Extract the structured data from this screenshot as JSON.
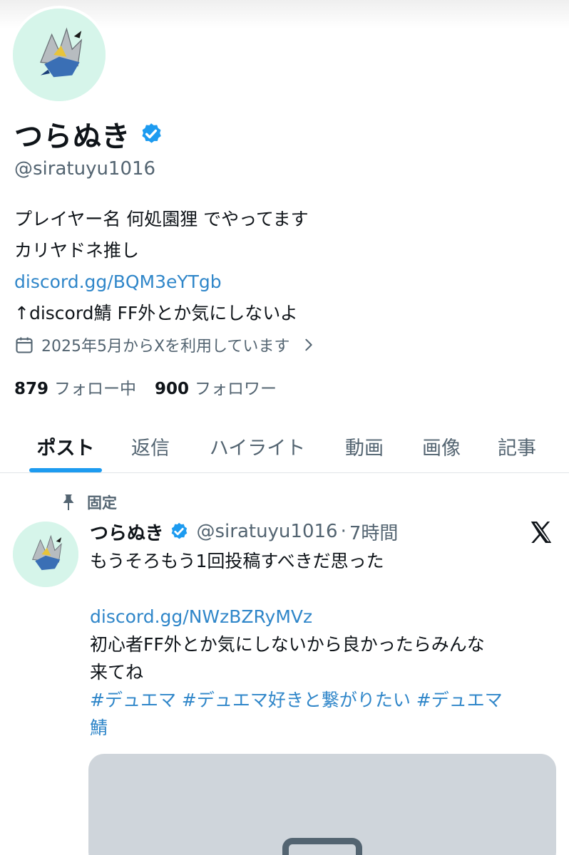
{
  "profile": {
    "display_name": "つらぬき",
    "handle": "@siratuyu1016",
    "bio": {
      "line1": "プレイヤー名 何処園狸 でやってます",
      "line2": "カリヤドネ推し",
      "link": "discord.gg/BQM3eYTgb",
      "line4": "↑discord鯖 FF外とか気にしないよ"
    },
    "joined": "2025年5月からXを利用しています",
    "following_count": "879",
    "following_label": "フォロー中",
    "followers_count": "900",
    "followers_label": "フォロワー"
  },
  "tabs": [
    {
      "label": "ポスト",
      "active": true
    },
    {
      "label": "返信"
    },
    {
      "label": "ハイライト"
    },
    {
      "label": "動画"
    },
    {
      "label": "画像"
    },
    {
      "label": "記事"
    }
  ],
  "pinned_post": {
    "pinned_label": "固定",
    "author_name": "つらぬき",
    "author_handle": "@siratuyu1016",
    "separator": "·",
    "time": "7時間",
    "text_line1": "もうそろもう1回投稿すべきだ思った",
    "link": "discord.gg/NWzBZRyMVz",
    "text_line3": "初心者FF外とか気にしないから良かったらみんな",
    "text_line4": "来てね",
    "hashtags_line1": " #デュエマ #デュエマ好きと繋がりたい #デュエマ",
    "hashtags_line2": "鯖"
  },
  "colors": {
    "accent": "#1d9bf0",
    "link": "#2f86c9",
    "secondary_text": "#536471",
    "avatar_bg": "#d6f5ea"
  },
  "icons": [
    "verified-badge-icon",
    "calendar-icon",
    "chevron-right-icon",
    "pin-icon",
    "x-logo-icon",
    "image-placeholder-icon"
  ]
}
